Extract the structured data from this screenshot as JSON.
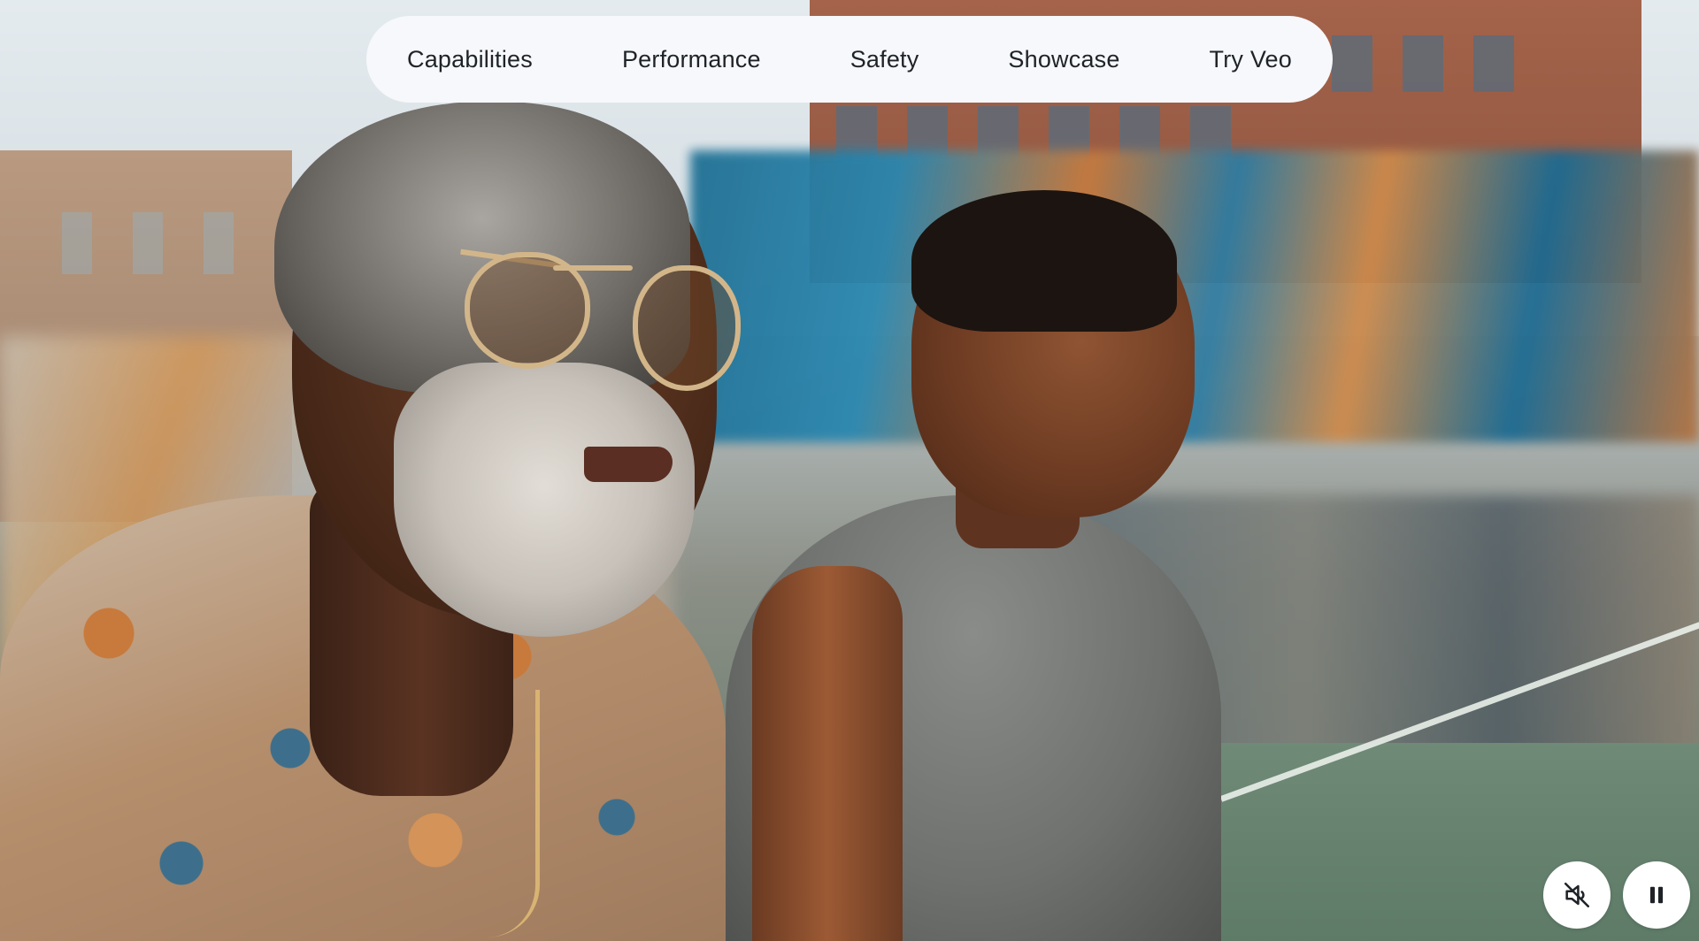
{
  "nav": {
    "items": [
      {
        "label": "Capabilities"
      },
      {
        "label": "Performance"
      },
      {
        "label": "Safety"
      },
      {
        "label": "Showcase"
      },
      {
        "label": "Try Veo"
      }
    ]
  },
  "controls": {
    "mute_icon": "volume-muted-icon",
    "pause_icon": "pause-icon"
  },
  "colors": {
    "nav_background": "#f6f8fb",
    "nav_text": "#1f2328",
    "control_background": "#ffffff",
    "control_icon": "#1f2328"
  }
}
